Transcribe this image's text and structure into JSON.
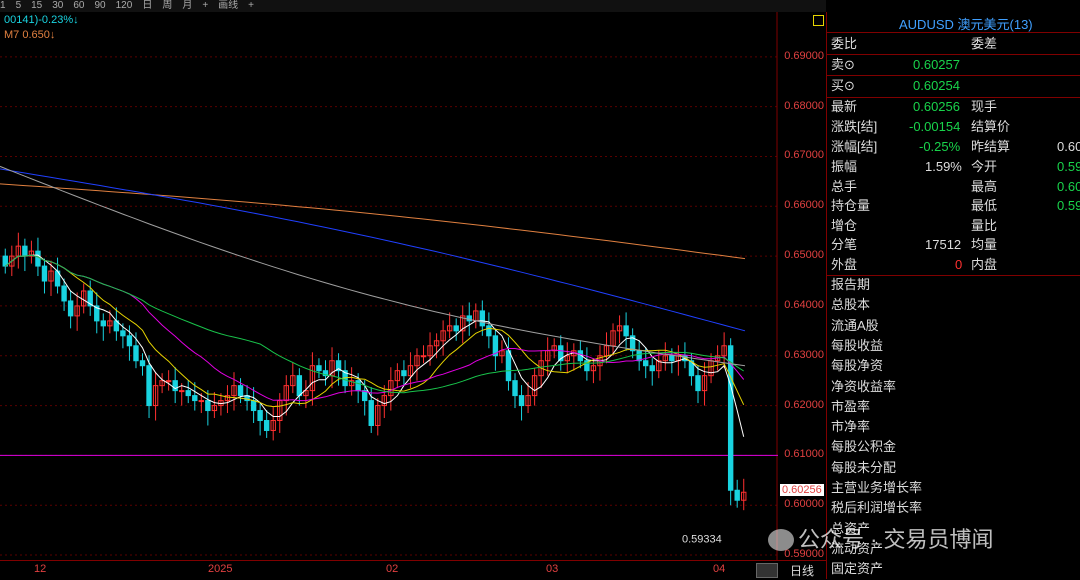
{
  "toolbar": {
    "items": [
      "1",
      "5",
      "15",
      "30",
      "60",
      "90",
      "120",
      "日",
      "周",
      "月",
      "+",
      "画线",
      "+"
    ]
  },
  "indicators": {
    "line1": "00141)-0.23%↓",
    "line2": "M7 0.650↓"
  },
  "colors": {
    "up": "#ff3030",
    "down": "#19d3e0",
    "ma5": "#ffffff",
    "ma10": "#e6d400",
    "ma20": "#e000e0",
    "ma60": "#19c34b",
    "ma120": "#a0a0a0",
    "ma250": "#2040ff",
    "ma500": "#e08040",
    "hline": "#e000e0"
  },
  "price_axis": {
    "ticks": [
      "0.69000",
      "0.68000",
      "0.67000",
      "0.66000",
      "0.65000",
      "0.64000",
      "0.63000",
      "0.62000",
      "0.61000",
      "0.60000",
      "0.59000"
    ],
    "current_price": "0.60256",
    "low_marker": "0.59334"
  },
  "x_axis": {
    "labels": [
      "12",
      "2025",
      "02",
      "03",
      "04"
    ],
    "right_label": "日线"
  },
  "chart_data": {
    "type": "candlestick",
    "ylim": [
      0.589,
      0.699
    ],
    "horizontal_line": 0.61,
    "candles_close_series": [
      0.648,
      0.65,
      0.652,
      0.65,
      0.651,
      0.648,
      0.645,
      0.647,
      0.644,
      0.641,
      0.638,
      0.64,
      0.643,
      0.64,
      0.637,
      0.636,
      0.637,
      0.635,
      0.634,
      0.632,
      0.629,
      0.628,
      0.62,
      0.624,
      0.625,
      0.625,
      0.623,
      0.623,
      0.622,
      0.621,
      0.621,
      0.619,
      0.62,
      0.621,
      0.622,
      0.624,
      0.622,
      0.621,
      0.619,
      0.617,
      0.615,
      0.617,
      0.621,
      0.624,
      0.626,
      0.622,
      0.623,
      0.628,
      0.627,
      0.626,
      0.629,
      0.627,
      0.624,
      0.625,
      0.623,
      0.621,
      0.616,
      0.62,
      0.622,
      0.625,
      0.627,
      0.626,
      0.628,
      0.63,
      0.63,
      0.632,
      0.633,
      0.635,
      0.636,
      0.635,
      0.638,
      0.637,
      0.639,
      0.636,
      0.634,
      0.63,
      0.631,
      0.625,
      0.622,
      0.62,
      0.622,
      0.626,
      0.629,
      0.631,
      0.632,
      0.629,
      0.63,
      0.631,
      0.629,
      0.627,
      0.628,
      0.63,
      0.632,
      0.635,
      0.636,
      0.634,
      0.631,
      0.629,
      0.628,
      0.627,
      0.629,
      0.63,
      0.629,
      0.63,
      0.629,
      0.626,
      0.623,
      0.626,
      0.629,
      0.63,
      0.632,
      0.603,
      0.601,
      0.6026
    ]
  },
  "panel": {
    "title": "AUDUSD 澳元美元(13)",
    "row_weibi": "委比",
    "row_weicha": "委差",
    "sell_label": "卖⊙",
    "sell_value": "0.60257",
    "buy_label": "买⊙",
    "buy_value": "0.60254",
    "latest_label": "最新",
    "latest_value": "0.60256",
    "now_hand": "现手",
    "change_label": "涨跌[结]",
    "change_value": "-0.00154",
    "settle_price": "结算价",
    "pct_label": "涨幅[结]",
    "pct_value": "-0.25%",
    "prev_settle": "昨结算",
    "prev_settle_value": "0.60",
    "amp_label": "振幅",
    "amp_value": "1.59%",
    "open_label": "今开",
    "open_value": "0.59",
    "volume_label": "总手",
    "high_label": "最高",
    "high_value": "0.60",
    "oi_label": "持仓量",
    "low_label": "最低",
    "low_value": "0.59",
    "add_label": "增仓",
    "ratio_label": "量比",
    "ticks_label": "分笔",
    "ticks_value": "17512",
    "avg_label": "均量",
    "outer_label": "外盘",
    "outer_value": "0",
    "inner_label": "内盘",
    "fund_items": [
      "报告期",
      "总股本",
      "流通A股",
      "每股收益",
      "每股净资",
      "净资收益率",
      "市盈率",
      "市净率",
      "每股公积金",
      "每股未分配",
      "主营业务增长率",
      "税后利润增长率",
      "总资产",
      "流动资产",
      "固定资产"
    ]
  },
  "watermark": "公众号 · 交易员博闻"
}
